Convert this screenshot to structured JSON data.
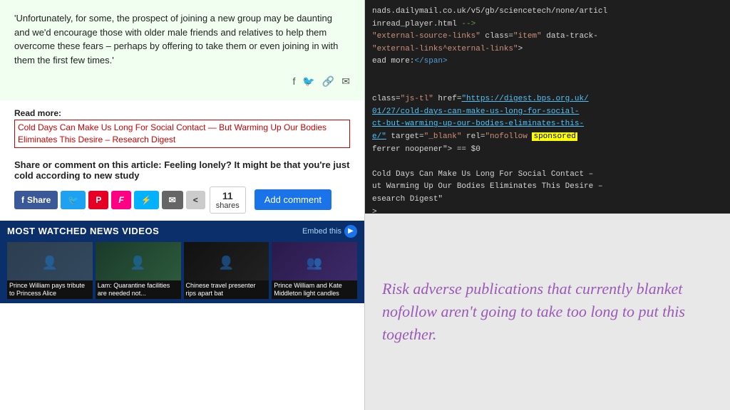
{
  "left": {
    "quote": "'Unfortunately, for some, the prospect of joining a new group may be daunting and we'd encourage those with older male friends and relatives to help them overcome these fears – perhaps by offering to take them or even joining in with them the first few times.'",
    "read_more_label": "Read more:",
    "read_more_link": "Cold Days Can Make Us Long For Social Contact — But Warming Up Our Bodies Eliminates This Desire – Research Digest",
    "share_title": "Share or comment on this article: Feeling lonely? It might be that you're just cold according to new study",
    "share_btn": "Share",
    "shares_num": "11",
    "shares_label": "shares",
    "add_comment": "Add comment",
    "most_watched_title": "MOST WATCHED NEWS VIDEOS",
    "embed_label": "Embed this",
    "videos": [
      {
        "label": "Prince William pays tribute to Princess Alice"
      },
      {
        "label": "Lam: Quarantine facilities are needed not..."
      },
      {
        "label": "Chinese travel presenter rips apart bat"
      },
      {
        "label": "Prince William and Kate Middleton light candles"
      }
    ]
  },
  "right": {
    "code_lines": [
      "nads.dailymail.co.uk/v5/gb/sciencetech/none/articl",
      "inread_player.html -->",
      "external-source-links\" class=\"item\" data-track-",
      "external-links^external-links\">",
      "ead more:</span>",
      "",
      "",
      "class=\"js-tl\" href=\"https://digest.bps.org.uk/",
      "01/27/cold-days-can-make-us-long-for-social-",
      "ct-but-warming-up-our-bodies-eliminates-this-",
      "e/\" target=\"_blank\" rel=\"nofollow sponsored",
      "ferrer noopener\"> == $0",
      "",
      "Cold Days Can Make Us Long For Social Contact –",
      "ut Warming Up Our Bodies Eliminates This Desire –",
      "esearch Digest\"",
      ">"
    ],
    "sponsored_word": "sponsored",
    "message": "Risk adverse publications that currently blanket nofollow aren't going to take too long to put this together."
  }
}
